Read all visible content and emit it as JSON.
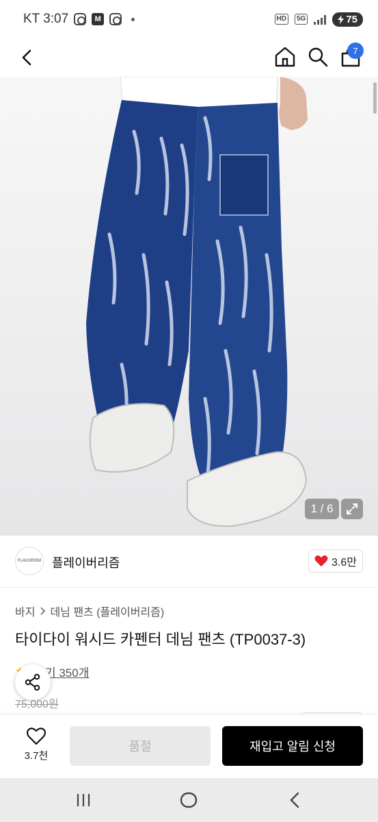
{
  "status_bar": {
    "carrier_time": "KT 3:07",
    "m_badge": "M",
    "hd": "HD",
    "network": "5G",
    "battery": "75"
  },
  "nav": {
    "cart_count": "7",
    "icons": [
      "back-arrow-icon",
      "home-icon",
      "search-icon",
      "cart-icon"
    ]
  },
  "gallery": {
    "counter": "1 / 6",
    "icons": [
      "expand-icon"
    ]
  },
  "brand": {
    "logo_text": "FLAVORISM",
    "name": "플레이버리즘",
    "likes": "3.6만"
  },
  "product": {
    "breadcrumb": [
      "바지",
      "데님 팬츠 (플레이버리즘)"
    ],
    "title": "타이다이 워시드 카펜터 데님 팬츠 (TP0037-3)",
    "review_count": "후기 350개",
    "original_price": "75,000원"
  },
  "action_bar": {
    "wish_count": "3.7천",
    "soldout_label": "품절",
    "restock_label": "재입고 알림 신청"
  },
  "colors": {
    "accent_blue": "#2f6fe8",
    "heart_red": "#e8202e",
    "denim": "#1e3f86",
    "primary_button": "#000000"
  }
}
